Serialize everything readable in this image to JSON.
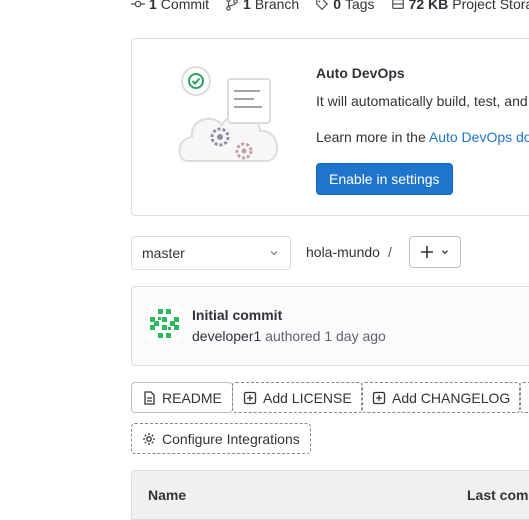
{
  "stats": [
    {
      "icon": "commit-icon",
      "count": "1",
      "label": "Commit"
    },
    {
      "icon": "branch-icon",
      "count": "1",
      "label": "Branch"
    },
    {
      "icon": "tag-icon",
      "count": "0",
      "label": "Tags"
    },
    {
      "icon": "storage-icon",
      "count": "72 KB",
      "label": "Project Storage"
    }
  ],
  "autodevops": {
    "title": "Auto DevOps",
    "description": "It will automatically build, test, and deploy your application based on a predefined CI/CD configuration.",
    "learn_prefix": "Learn more in the ",
    "learn_link": "Auto DevOps documentation",
    "button": "Enable in settings"
  },
  "branch": {
    "selected": "master",
    "project": "hola-mundo",
    "separator": "/"
  },
  "commit": {
    "title": "Initial commit",
    "author": "developer1",
    "meta": "authored 1 day ago"
  },
  "actions": [
    {
      "label": "README",
      "icon": "file-icon",
      "style": "solid"
    },
    {
      "label": "Add LICENSE",
      "icon": "plus-square-icon",
      "style": "dashed"
    },
    {
      "label": "Add CHANGELOG",
      "icon": "plus-square-icon",
      "style": "dashed"
    },
    {
      "label": "Configure Integrations",
      "icon": "gear-icon",
      "style": "dashed"
    }
  ],
  "table": {
    "col_name": "Name",
    "col_last_commit": "Last commit"
  },
  "colors": {
    "primary": "#1f75cb",
    "link": "#1f75cb",
    "avatar": "#2eb85c"
  }
}
